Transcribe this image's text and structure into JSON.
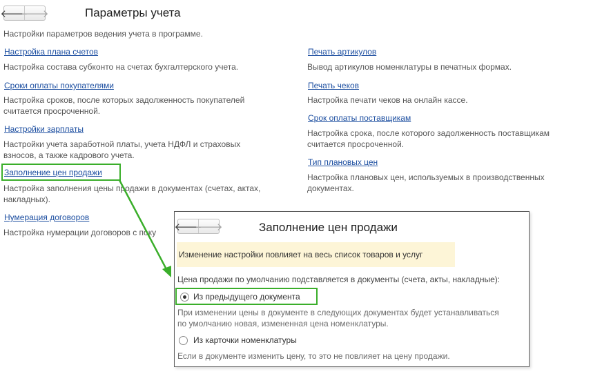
{
  "header": {
    "title": "Параметры учета",
    "description": "Настройки параметров ведения учета в программе.",
    "back_icon": "arrow-left-icon",
    "forward_icon": "arrow-right-icon"
  },
  "left_column": [
    {
      "link": "Настройка плана счетов",
      "desc": "Настройка состава субконто на счетах бухгалтерского учета."
    },
    {
      "link": "Сроки оплаты покупателями",
      "desc": "Настройка сроков, после которых задолженность покупателей считается просроченной."
    },
    {
      "link": "Настройки зарплаты",
      "desc": "Настройки учета заработной платы, учета НДФЛ и страховых взносов, а также кадрового учета."
    },
    {
      "link": "Заполнение цен продажи",
      "desc": "Настройка заполнения цены продажи в документах (счетах, актах, накладных)."
    },
    {
      "link": "Нумерация договоров",
      "desc": "Настройка нумерации договоров с поку"
    }
  ],
  "right_column": [
    {
      "link": "Печать артикулов",
      "desc": "Вывод артикулов номенклатуры в печатных формах."
    },
    {
      "link": "Печать чеков",
      "desc": "Настройка печати чеков на онлайн кассе."
    },
    {
      "link": "Срок оплаты поставщикам",
      "desc": "Настройка срока, после которого задолженность поставщикам считается просроченной."
    },
    {
      "link": "Тип плановых цен",
      "desc": "Настройка плановых цен, используемых в производственных документах."
    }
  ],
  "popup": {
    "title": "Заполнение цен продажи",
    "warning": "Изменение настройки повлияет на весь список товаров и услуг",
    "question": "Цена продажи по умолчанию подставляется в документы (счета, акты, накладные):",
    "options": [
      {
        "label": "Из предыдущего документа",
        "selected": true,
        "hint": "При изменении цены в документе в следующих документах будет устанавливаться по умолчанию новая, измененная цена номенклатуры."
      },
      {
        "label": "Из карточки номенклатуры",
        "selected": false,
        "hint": "Если в документе изменить цену, то это не повлияет на цену продажи."
      }
    ]
  },
  "colors": {
    "link": "#1c4ea0",
    "highlight": "#3aae2a",
    "warning_bg": "#fdf5d7"
  }
}
